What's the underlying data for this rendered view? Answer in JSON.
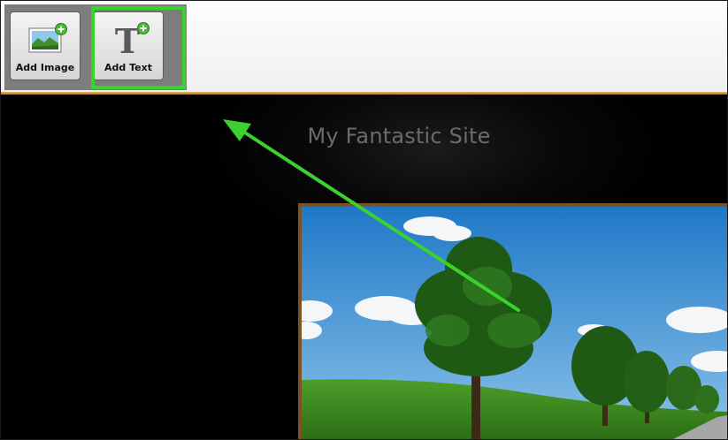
{
  "toolbar": {
    "add_image_label": "Add Image",
    "add_text_label": "Add Text",
    "text_icon_glyph": "T"
  },
  "canvas": {
    "site_title": "My Fantastic Site"
  },
  "icons": {
    "add_image": "landscape-picture-plus-icon",
    "add_text": "letter-t-plus-icon"
  },
  "colors": {
    "highlight": "#36d52c",
    "accent_gold": "#c48a3a",
    "canvas_bg": "#000000",
    "site_title": "#6b6b6b"
  }
}
